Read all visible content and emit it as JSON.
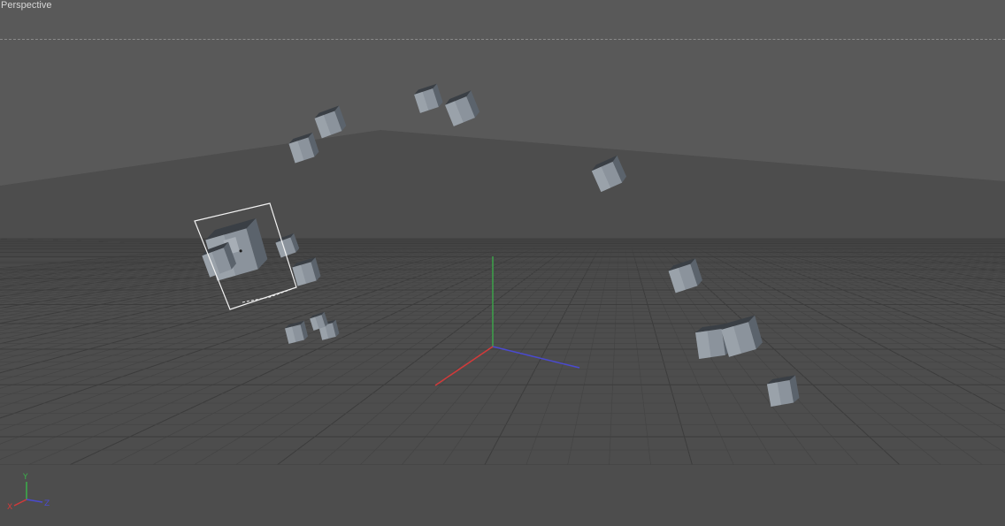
{
  "viewport": {
    "title": "Perspective",
    "colors": {
      "background_top": "#595959",
      "background_floor": "#4e4e4e",
      "grid_minor": "#444444",
      "grid_major": "#3c3c3c",
      "cube_top": "#a7aeb6",
      "cube_front": "#8b939c",
      "cube_side": "#5b636c",
      "cube_dark": "#3a3f45",
      "selection": "#f2f2f2",
      "axis_x": "#d23a3a",
      "axis_y": "#3bb04a",
      "axis_z": "#4a4ad0"
    }
  },
  "world_axis_icon": {
    "label_x": "X",
    "label_y": "Y",
    "label_z": "Z"
  },
  "scene": {
    "objects": [
      {
        "name": "cube-1",
        "selected": false
      },
      {
        "name": "cube-2",
        "selected": false
      },
      {
        "name": "cube-3",
        "selected": false
      },
      {
        "name": "cube-4",
        "selected": false
      },
      {
        "name": "cube-5",
        "selected": false
      },
      {
        "name": "cube-6",
        "selected": true
      },
      {
        "name": "cube-7",
        "selected": false
      },
      {
        "name": "cube-8",
        "selected": false
      },
      {
        "name": "cube-9",
        "selected": false
      },
      {
        "name": "cube-10",
        "selected": false
      },
      {
        "name": "cube-11",
        "selected": false
      },
      {
        "name": "cube-12",
        "selected": false
      },
      {
        "name": "cube-13",
        "selected": false
      },
      {
        "name": "cube-14",
        "selected": false
      },
      {
        "name": "cube-15",
        "selected": false
      },
      {
        "name": "cube-16",
        "selected": false
      }
    ]
  }
}
